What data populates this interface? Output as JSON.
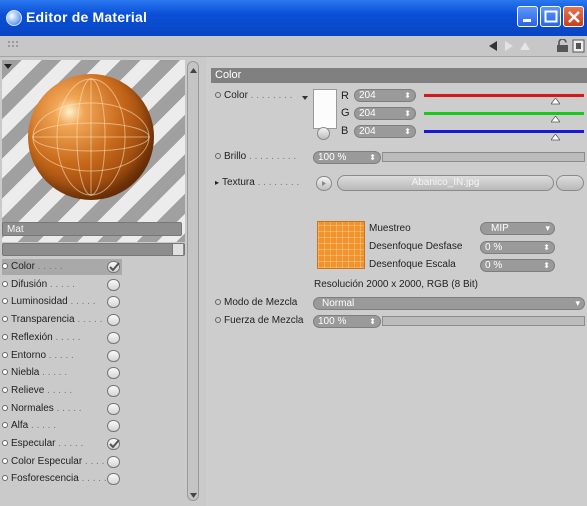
{
  "window": {
    "title": "Editor de Material"
  },
  "preview": {
    "material_name": "Mat"
  },
  "channels": [
    {
      "label": "Color",
      "enabled": true,
      "selected": true
    },
    {
      "label": "Difusión",
      "enabled": false
    },
    {
      "label": "Luminosidad",
      "enabled": false
    },
    {
      "label": "Transparencia",
      "enabled": false
    },
    {
      "label": "Reflexión",
      "enabled": false
    },
    {
      "label": "Entorno",
      "enabled": false
    },
    {
      "label": "Niebla",
      "enabled": false
    },
    {
      "label": "Relieve",
      "enabled": false
    },
    {
      "label": "Normales",
      "enabled": false
    },
    {
      "label": "Alfa",
      "enabled": false
    },
    {
      "label": "Especular",
      "enabled": true
    },
    {
      "label": "Color Especular",
      "enabled": false
    },
    {
      "label": "Fosforescencia",
      "enabled": false
    }
  ],
  "color_section": {
    "header": "Color",
    "color_label": "Color",
    "r_label": "R",
    "r_value": "204",
    "g_label": "G",
    "g_value": "204",
    "b_label": "B",
    "b_value": "204",
    "brillo_label": "Brillo",
    "brillo_value": "100 %",
    "brillo_percent": 100,
    "textura_label": "Textura",
    "texture_file": "Abanico_IN.jpg",
    "muestreo_label": "Muestreo",
    "muestreo_value": "MIP",
    "desplaz_label": "Desenfoque Desfase",
    "desplaz_value": "0 %",
    "escala_label": "Desenfoque Escala",
    "escala_value": "0 %",
    "resolution": "Resolución 2000 x 2000, RGB (8 Bit)",
    "modo_label": "Modo de Mezcla",
    "modo_value": "Normal",
    "fuerza_label": "Fuerza de Mezcla",
    "fuerza_value": "100 %",
    "fuerza_percent": 100
  },
  "colors": {
    "accent_orange": "#f1932b",
    "slider_red": "#d81818",
    "slider_green": "#18c818",
    "slider_blue": "#1818d8"
  }
}
